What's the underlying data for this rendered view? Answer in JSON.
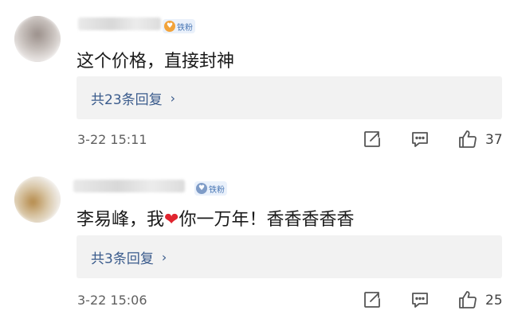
{
  "comments": [
    {
      "badge_label": "铁粉",
      "text": "这个价格，直接封神",
      "reply_summary": "共23条回复",
      "chevron": "›",
      "timestamp": "3-22 15:11",
      "like_count": "37"
    },
    {
      "badge_label": "铁粉",
      "text_before": "李易峰，我",
      "text_heart": "❤",
      "text_after": "你一万年！香香香香香",
      "reply_summary": "共3条回复",
      "chevron": "›",
      "timestamp": "3-22 15:06",
      "like_count": "25"
    }
  ],
  "icons": {
    "forward": "forward-icon",
    "reply": "comment-icon",
    "like": "thumbs-up-icon"
  },
  "colors": {
    "link_blue": "#3a5b8c",
    "heart_red": "#e0252f",
    "reply_bg": "#f2f2f2"
  }
}
